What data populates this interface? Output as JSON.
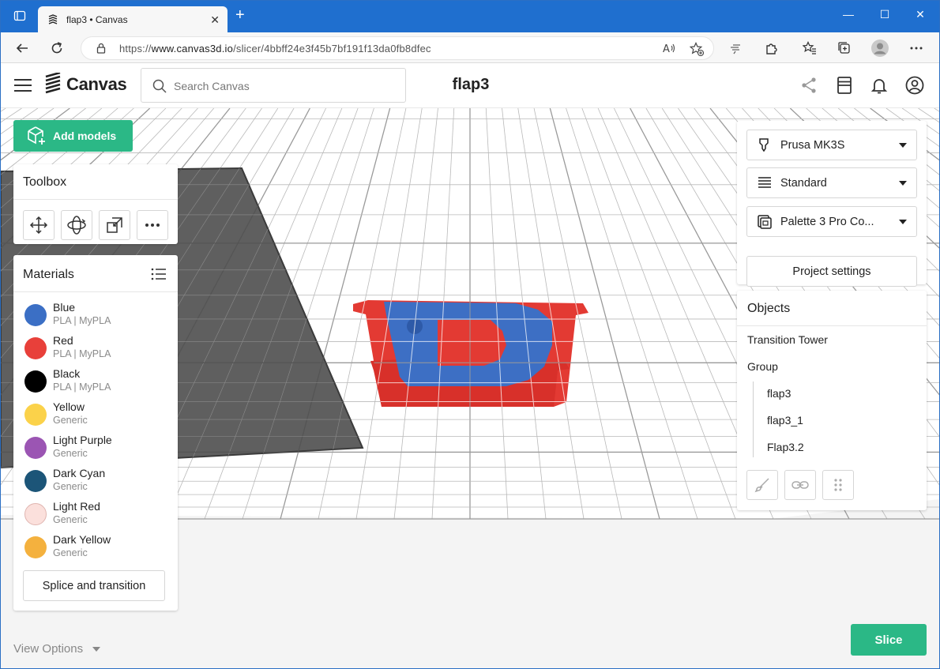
{
  "browser": {
    "tab_title": "flap3 • Canvas",
    "tab_close": "✕",
    "new_tab": "+",
    "url_prefix": "https://",
    "url_host": "www.canvas3d.io",
    "url_path": "/slicer/4bbff24e3f45b7bf191f13da0fb8dfec",
    "window_controls": [
      "—",
      "☐",
      "✕"
    ]
  },
  "app": {
    "logo_text": "Canvas",
    "search_placeholder": "Search Canvas",
    "page_title": "flap3",
    "brand_color": "#2bb886"
  },
  "sidebar": {
    "add_models_label": "Add models",
    "toolbox_title": "Toolbox",
    "tools": [
      "move-icon",
      "rotate-icon",
      "scale-icon",
      "more-icon"
    ],
    "materials_title": "Materials",
    "materials": [
      {
        "name": "Blue",
        "sub": "PLA | MyPLA",
        "color": "#3b6fc5"
      },
      {
        "name": "Red",
        "sub": "PLA | MyPLA",
        "color": "#e8403a"
      },
      {
        "name": "Black",
        "sub": "PLA | MyPLA",
        "color": "#000000"
      },
      {
        "name": "Yellow",
        "sub": "Generic",
        "color": "#fbd24a"
      },
      {
        "name": "Light Purple",
        "sub": "Generic",
        "color": "#9b55b3"
      },
      {
        "name": "Dark Cyan",
        "sub": "Generic",
        "color": "#1c5578"
      },
      {
        "name": "Light Red",
        "sub": "Generic",
        "color": "#fbe0dc"
      },
      {
        "name": "Dark Yellow",
        "sub": "Generic",
        "color": "#f4b13e"
      }
    ],
    "splice_label": "Splice and transition"
  },
  "settings": {
    "printer": "Prusa MK3S",
    "profile": "Standard",
    "device": "Palette 3 Pro Co...",
    "project_settings_label": "Project settings"
  },
  "objects": {
    "title": "Objects",
    "transition_tower": "Transition Tower",
    "group": "Group",
    "children": [
      "flap3",
      "flap3_1",
      "Flap3.2"
    ]
  },
  "footer": {
    "view_options_label": "View Options",
    "slice_label": "Slice"
  }
}
